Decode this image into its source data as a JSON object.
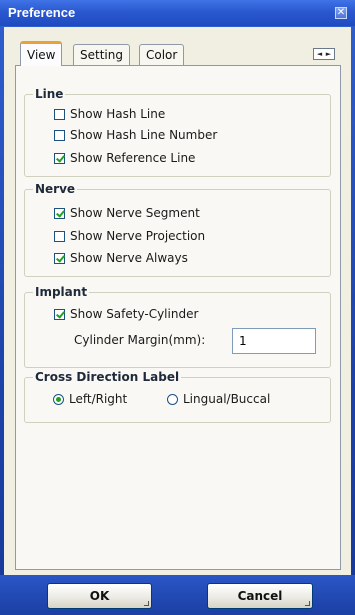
{
  "window": {
    "title": "Preference",
    "close_glyph": "✕"
  },
  "tabs": [
    {
      "label": "View",
      "active": true
    },
    {
      "label": "Setting",
      "active": false
    },
    {
      "label": "Color",
      "active": false
    }
  ],
  "tab_scroll": {
    "left": "◄",
    "right": "►"
  },
  "groups": {
    "line": {
      "title": "Line",
      "options": [
        {
          "label": "Show Hash Line",
          "checked": false
        },
        {
          "label": "Show Hash Line Number",
          "checked": false
        },
        {
          "label": "Show Reference Line",
          "checked": true
        }
      ]
    },
    "nerve": {
      "title": "Nerve",
      "options": [
        {
          "label": "Show Nerve Segment",
          "checked": true
        },
        {
          "label": "Show Nerve Projection",
          "checked": false
        },
        {
          "label": "Show Nerve Always",
          "checked": true
        }
      ]
    },
    "implant": {
      "title": "Implant",
      "options": [
        {
          "label": "Show Safety-Cylinder",
          "checked": true
        }
      ],
      "margin_label": "Cylinder Margin(mm):",
      "margin_value": "1"
    },
    "cross_direction": {
      "title": "Cross Direction Label",
      "options": [
        {
          "label": "Left/Right",
          "selected": true
        },
        {
          "label": "Lingual/Buccal",
          "selected": false
        }
      ]
    }
  },
  "buttons": {
    "ok": "OK",
    "cancel": "Cancel"
  },
  "colors": {
    "title_bar": "#2a58cf",
    "tab_accent": "#e9a23a",
    "check_mark": "#21a121"
  }
}
